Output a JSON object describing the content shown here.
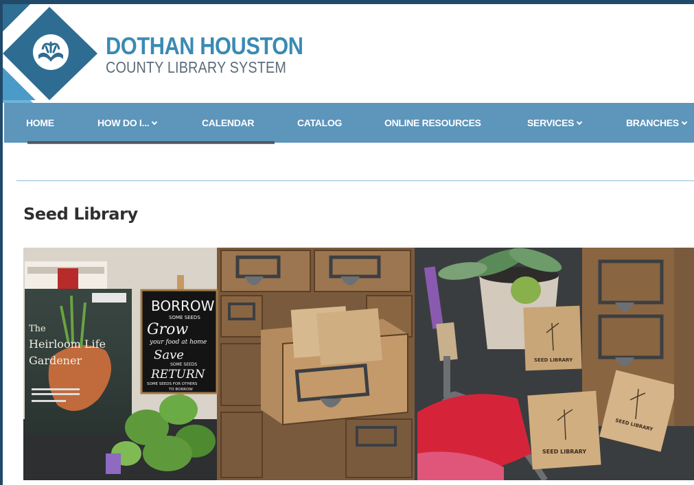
{
  "header": {
    "logo_line1": "DOTHAN HOUSTON",
    "logo_line2": "COUNTY LIBRARY SYSTEM",
    "logo_icon": "open-book-icon"
  },
  "nav": {
    "items": [
      {
        "label": "HOME",
        "has_dropdown": false
      },
      {
        "label": "HOW DO I...",
        "has_dropdown": true
      },
      {
        "label": "CALENDAR",
        "has_dropdown": false
      },
      {
        "label": "CATALOG",
        "has_dropdown": false
      },
      {
        "label": "ONLINE RESOURCES",
        "has_dropdown": false
      },
      {
        "label": "SERVICES",
        "has_dropdown": true
      },
      {
        "label": "BRANCHES",
        "has_dropdown": true
      }
    ]
  },
  "page": {
    "title": "Seed Library"
  },
  "photo": {
    "book": {
      "line1": "The",
      "line2": "Heirloom Life",
      "line3": "Gardener"
    },
    "chalkboard": {
      "line1": "BORROW",
      "line2": "SOME SEEDS",
      "line3": "Grow",
      "line4": "your food at home",
      "line5": "Save",
      "line6": "SOME SEEDS",
      "line7": "RETURN",
      "line8": "SOME SEEDS FOR OTHERS",
      "line9": "TO BORROW"
    },
    "packet_label": "SEED LIBRARY"
  },
  "colors": {
    "nav_bg": "#5d95bb",
    "brand_blue": "#3a8ab4",
    "frame": "#21496a"
  }
}
